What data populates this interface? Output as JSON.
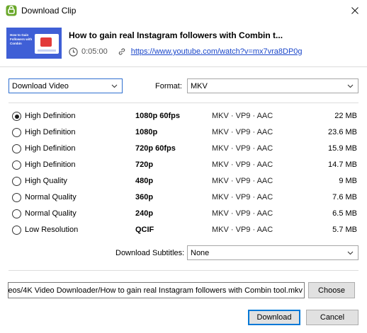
{
  "window": {
    "title": "Download Clip"
  },
  "clip": {
    "title": "How to gain real Instagram followers with Combin t...",
    "duration": "0:05:00",
    "url": "https://www.youtube.com/watch?v=mx7vra8DP0g",
    "thumbnail_text": "How to Gain Followers with Combin"
  },
  "download_type": {
    "selected": "Download Video"
  },
  "format": {
    "label": "Format:",
    "selected": "MKV"
  },
  "options": [
    {
      "quality": "High Definition",
      "resolution": "1080p 60fps",
      "codec": "MKV · VP9 · AAC",
      "size": "22 MB",
      "checked": true
    },
    {
      "quality": "High Definition",
      "resolution": "1080p",
      "codec": "MKV · VP9 · AAC",
      "size": "23.6 MB",
      "checked": false
    },
    {
      "quality": "High Definition",
      "resolution": "720p 60fps",
      "codec": "MKV · VP9 · AAC",
      "size": "15.9 MB",
      "checked": false
    },
    {
      "quality": "High Definition",
      "resolution": "720p",
      "codec": "MKV · VP9 · AAC",
      "size": "14.7 MB",
      "checked": false
    },
    {
      "quality": "High Quality",
      "resolution": "480p",
      "codec": "MKV · VP9 · AAC",
      "size": "9 MB",
      "checked": false
    },
    {
      "quality": "Normal Quality",
      "resolution": "360p",
      "codec": "MKV · VP9 · AAC",
      "size": "7.6 MB",
      "checked": false
    },
    {
      "quality": "Normal Quality",
      "resolution": "240p",
      "codec": "MKV · VP9 · AAC",
      "size": "6.5 MB",
      "checked": false
    },
    {
      "quality": "Low Resolution",
      "resolution": "QCIF",
      "codec": "MKV · VP9 · AAC",
      "size": "5.7 MB",
      "checked": false
    }
  ],
  "subtitles": {
    "label": "Download Subtitles:",
    "selected": "None"
  },
  "path": {
    "value": "eos/4K Video Downloader/How to gain real Instagram followers with Combin tool.mkv"
  },
  "buttons": {
    "choose": "Choose",
    "download": "Download",
    "cancel": "Cancel"
  },
  "colors": {
    "accent": "#0078d7",
    "link": "#1a46c9",
    "app_icon": "#6aa82b",
    "thumb_bg": "#3f5fd6"
  }
}
